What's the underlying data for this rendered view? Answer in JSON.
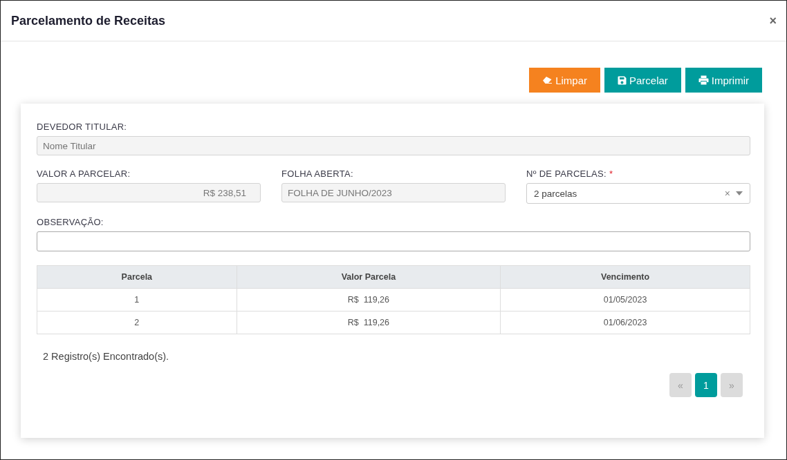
{
  "window": {
    "title": "Parcelamento de Receitas",
    "close": "×"
  },
  "toolbar": [
    {
      "label": "Limpar",
      "kind": "clear"
    },
    {
      "label": "Parcelar",
      "kind": "save"
    },
    {
      "label": "Imprimir",
      "kind": "print"
    }
  ],
  "form_rows": [
    [
      {
        "label": "DEVEDOR TITULAR:",
        "kind": "text",
        "placeholder": "Nome Titular",
        "disabled": true
      }
    ],
    [
      {
        "label": "VALOR A PARCELAR:",
        "kind": "money",
        "value": "R$ 238,51",
        "disabled": true
      },
      {
        "label": "FOLHA ABERTA:",
        "kind": "text",
        "value": "FOLHA DE JUNHO/2023",
        "disabled": true
      },
      {
        "label": "Nº DE PARCELAS:",
        "required_mark": "*",
        "kind": "select",
        "value": "2 parcelas",
        "clear": "×",
        "disabled": false
      }
    ],
    [
      {
        "label": "OBSERVAÇÃO:",
        "kind": "text",
        "disabled": false
      }
    ]
  ],
  "table": {
    "columns": [
      "Parcela",
      "Valor Parcela",
      "Vencimento"
    ],
    "rows": [
      [
        "1",
        "R$  119,26",
        "01/05/2023"
      ],
      [
        "2",
        "R$  119,26",
        "01/06/2023"
      ]
    ]
  },
  "records": "2 Registro(s) Encontrado(s).",
  "pager": {
    "prev": {
      "label": "«",
      "disabled": true
    },
    "pages": [
      {
        "label": "1",
        "selected": true
      }
    ],
    "next": {
      "label": "»",
      "disabled": true
    }
  }
}
